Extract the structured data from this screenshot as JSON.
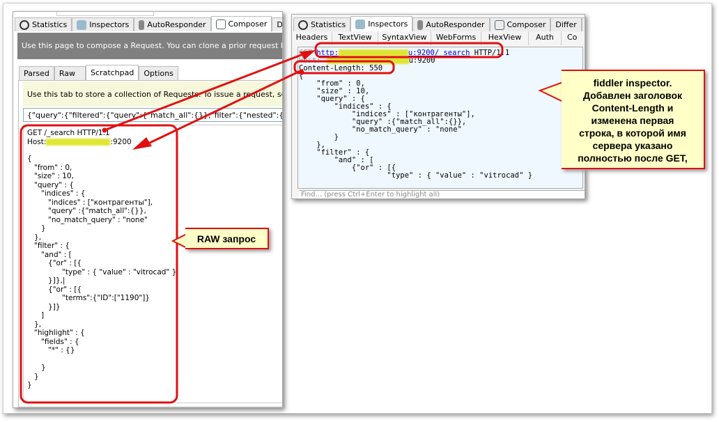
{
  "left": {
    "tabs": [
      "Statistics",
      "Inspectors",
      "AutoResponder",
      "Composer",
      "Differ"
    ],
    "active_tab": "Composer",
    "banner": "Use this page to compose a Request. You can clone a prior request by drag",
    "subtabs": [
      "Parsed",
      "Raw",
      "Scratchpad",
      "Options"
    ],
    "hint": "Use this tab to store a collection of Requests. To issue a request, select i",
    "json_line": "{\"query\":{\"filtered\":{\"query\":{\"match_all\":{}},\"filter\":{\"nested\":{\"path\":\"нси",
    "request_line": "GET /_search HTTP/1.1",
    "host_label": "Host:",
    "host_port": ":9200",
    "body": "{\n   \"from\" : 0,\n   \"size\" : 10,\n   \"query\" : {\n      \"indices\" : {\n         \"indices\" : [\"контрагенты\"],\n         \"query\" :{\"match_all\":{}},\n         \"no_match_query\" : \"none\"\n      }\n   },\n   \"filter\" : {\n      \"and\" : [\n         {\"or\" : [{\n               \"type\" : { \"value\" : \"vitrocad\" }\n         }]},|\n         {\"or\" : [{\n               \"terms\":{\"ID\":[\"1190\"]}\n         }]}\n      ]\n   },\n   \"highlight\" : {\n      \"fields\" : {\n         \"*\" : {}\n\n      }\n   }\n}"
  },
  "right": {
    "tabs": [
      "Statistics",
      "Inspectors",
      "AutoResponder",
      "Composer",
      "Differ"
    ],
    "active_tab": "Inspectors",
    "subtabs": [
      "Headers",
      "TextView",
      "SyntaxView",
      "WebForms",
      "HexView",
      "Auth",
      "Co"
    ],
    "get": "GET",
    "url_start": "http:",
    "url_end": "u:9200/_search",
    "http_version": " HTTP/1.1",
    "host_label": "Host:",
    "host_port": "u:9200",
    "content_length": "Content-Length: 550",
    "body": "{\n    \"from\" : 0,\n    \"size\" : 10,\n    \"query\" : {\n        \"indices\" : {\n            \"indices\" : [\"контрагенты\"],\n            \"query\" :{\"match_all\":{}},\n            \"no_match_query\" : \"none\"\n        }\n    },\n    \"filter\" : {\n        \"and\" : [\n            {\"or\" : [{\n                    \"type\" : { \"value\" : \"vitrocad\" }",
    "find_placeholder": "Find... (press Ctrl+Enter to highlight all)"
  },
  "callouts": {
    "inspector": "fiddler inspector.\nДобавлен заголовок\nContent-Length и\nизменена первая\nстрока, в которой имя\nсервера указано\nполностью после GET,",
    "raw": "RAW запрос"
  },
  "colors": {
    "annotation": "#e01010",
    "callout_bg": "#ffffc8",
    "highlight": "#d9e000",
    "banner": "#808080"
  }
}
